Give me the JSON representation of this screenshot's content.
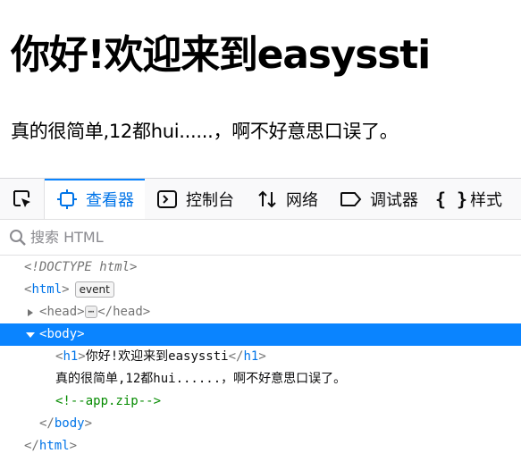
{
  "page": {
    "heading": "你好!欢迎来到easyssti",
    "body_text": "真的很简单,12都hui......，啊不好意思口误了。"
  },
  "devtools": {
    "tabs": [
      {
        "label": "查看器",
        "icon": "inspector-icon",
        "selected": true
      },
      {
        "label": "控制台",
        "icon": "console-icon"
      },
      {
        "label": "网络",
        "icon": "network-icon"
      },
      {
        "label": "调试器",
        "icon": "debugger-icon"
      },
      {
        "label": "样式",
        "icon": "style-editor-icon"
      }
    ],
    "search_placeholder": "搜索 HTML",
    "tree": {
      "doctype": "<!DOCTYPE html>",
      "html_open": "html",
      "event_badge": "event",
      "head": "head",
      "head_ellipsis": "⋯",
      "body": "body",
      "h1_tag": "h1",
      "h1_text": "你好!欢迎来到easyssti",
      "text_node": "真的很简单,12都hui......，啊不好意思口误了。",
      "comment": "<!--app.zip-->",
      "body_close": "body",
      "html_close": "html"
    }
  }
}
